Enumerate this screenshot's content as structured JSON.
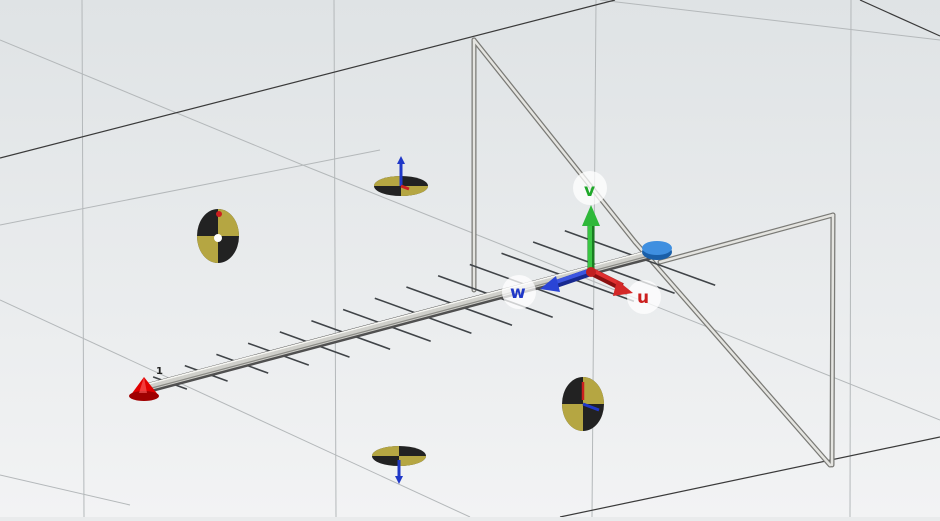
{
  "viewport": {
    "background_top": "#dfe3e5",
    "background_bottom": "#f2f3f4",
    "grid_color": "#b4b8ba",
    "edge_color": "#3a3a3a"
  },
  "antenna": {
    "element_count": 14,
    "port_number": "1",
    "boom_color": "#d4d4d0",
    "element_color": "#404448"
  },
  "axes": {
    "u_label": "u",
    "v_label": "v",
    "w_label": "w",
    "u_color": "#cc1f1f",
    "v_color": "#1fa82a",
    "w_color": "#2038c8"
  },
  "markers": {
    "source_color": "#e00000",
    "probe_color": "#b5a642"
  }
}
